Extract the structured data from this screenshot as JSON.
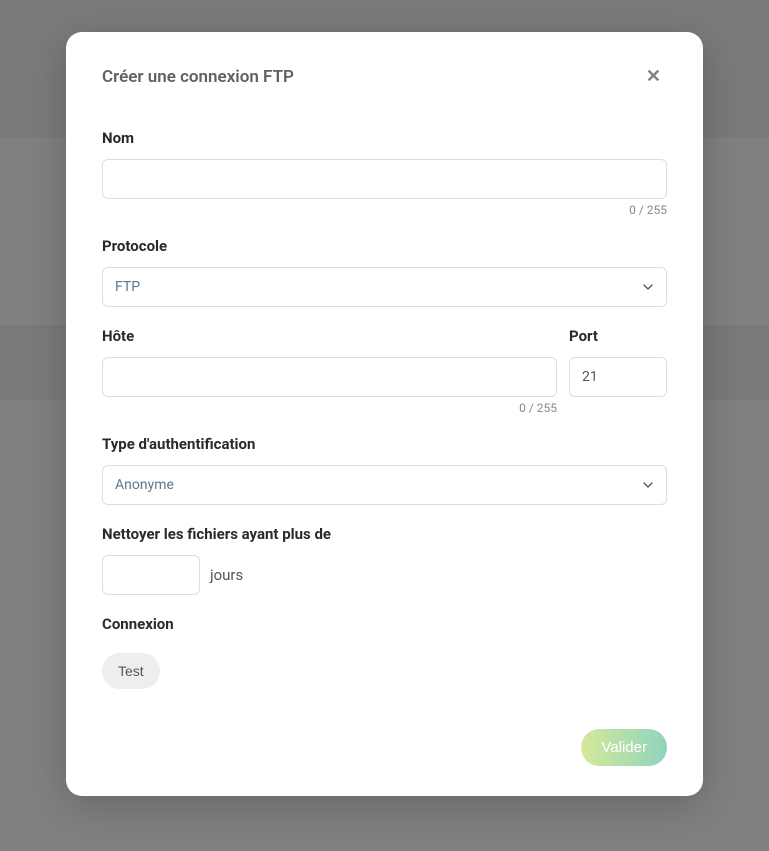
{
  "modal": {
    "title": "Créer une connexion FTP"
  },
  "form": {
    "name": {
      "label": "Nom",
      "value": "",
      "counter": "0 / 255"
    },
    "protocol": {
      "label": "Protocole",
      "selected": "FTP"
    },
    "host": {
      "label": "Hôte",
      "value": "",
      "counter": "0 / 255"
    },
    "port": {
      "label": "Port",
      "value": "21"
    },
    "authType": {
      "label": "Type d'authentification",
      "selected": "Anonyme"
    },
    "cleanFiles": {
      "label": "Nettoyer les fichiers ayant plus de",
      "value": "",
      "unit": "jours"
    },
    "connection": {
      "label": "Connexion",
      "testLabel": "Test"
    }
  },
  "footer": {
    "validateLabel": "Valider"
  }
}
